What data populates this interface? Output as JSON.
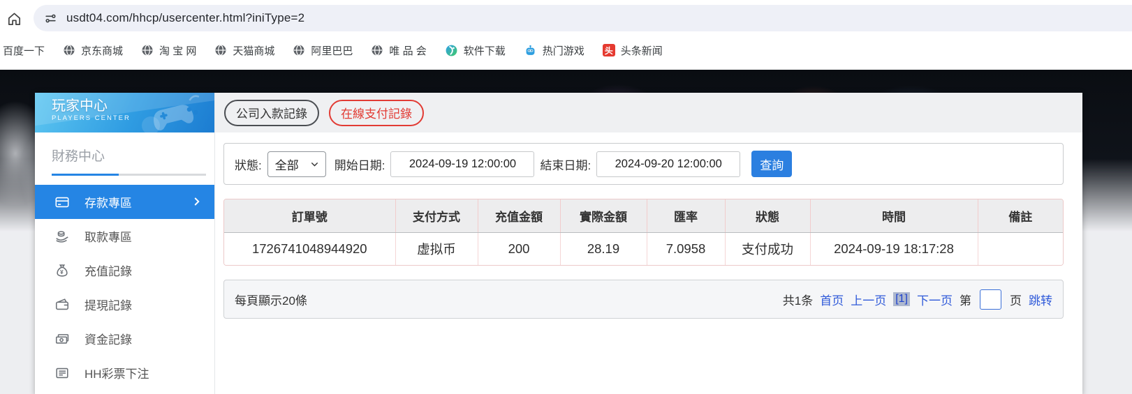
{
  "browser": {
    "url": "usdt04.com/hhcp/usercenter.html?iniType=2",
    "bookmarks": [
      {
        "label": "百度一下",
        "icon": "none"
      },
      {
        "label": "京东商城",
        "icon": "globe-icon"
      },
      {
        "label": "淘 宝 网",
        "icon": "globe-icon"
      },
      {
        "label": "天猫商城",
        "icon": "globe-icon"
      },
      {
        "label": "阿里巴巴",
        "icon": "globe-icon"
      },
      {
        "label": "唯 品 会",
        "icon": "globe-icon"
      },
      {
        "label": "软件下载",
        "icon": "download-icon"
      },
      {
        "label": "热门游戏",
        "icon": "game-icon"
      },
      {
        "label": "头条新闻",
        "icon": "toutiao-icon",
        "badge": "头"
      }
    ]
  },
  "sidebar": {
    "title": "玩家中心",
    "subtitle": "PLAYERS CENTER",
    "section_label": "財務中心",
    "items": [
      {
        "label": "存款專區",
        "icon": "bank-card-icon",
        "active": true
      },
      {
        "label": "取款專區",
        "icon": "hand-coins-icon",
        "active": false
      },
      {
        "label": "充值記錄",
        "icon": "money-bag-icon",
        "active": false
      },
      {
        "label": "提現記錄",
        "icon": "wallet-icon",
        "active": false
      },
      {
        "label": "資金記錄",
        "icon": "banknotes-icon",
        "active": false
      },
      {
        "label": "HH彩票下注",
        "icon": "ticket-list-icon",
        "active": false
      }
    ]
  },
  "tabs": [
    {
      "label": "公司入款記錄",
      "active": false
    },
    {
      "label": "在線支付記錄",
      "active": true
    }
  ],
  "filters": {
    "status_label": "狀態:",
    "status_value": "全部",
    "start_label": "開始日期:",
    "start_value": "2024-09-19 12:00:00",
    "end_label": "結束日期:",
    "end_value": "2024-09-20 12:00:00",
    "query_label": "查詢"
  },
  "table": {
    "columns": [
      "訂單號",
      "支付方式",
      "充值金額",
      "實際金額",
      "匯率",
      "狀態",
      "時間",
      "備註"
    ],
    "rows": [
      [
        "1726741048944920",
        "虚拟币",
        "200",
        "28.19",
        "7.0958",
        "支付成功",
        "2024-09-19 18:17:28",
        ""
      ]
    ]
  },
  "pagination": {
    "page_size_text": "每頁顯示20條",
    "total_text": "共1条",
    "first_label": "首页",
    "prev_label": "上一页",
    "current_label": "[1]",
    "next_label": "下一页",
    "jump_prefix": "第",
    "jump_suffix": "页",
    "jump_label": "跳转",
    "page_input_value": ""
  },
  "colors": {
    "accent_blue": "#2585e4",
    "query_button_blue": "#2b7fe0",
    "active_tab_red": "#e23b34",
    "link_blue": "#2e59d9",
    "table_border_pink": "#f1cccc",
    "sidebar_header_gradient_start": "#5ec7f1",
    "sidebar_header_gradient_end": "#1c7cd1"
  }
}
